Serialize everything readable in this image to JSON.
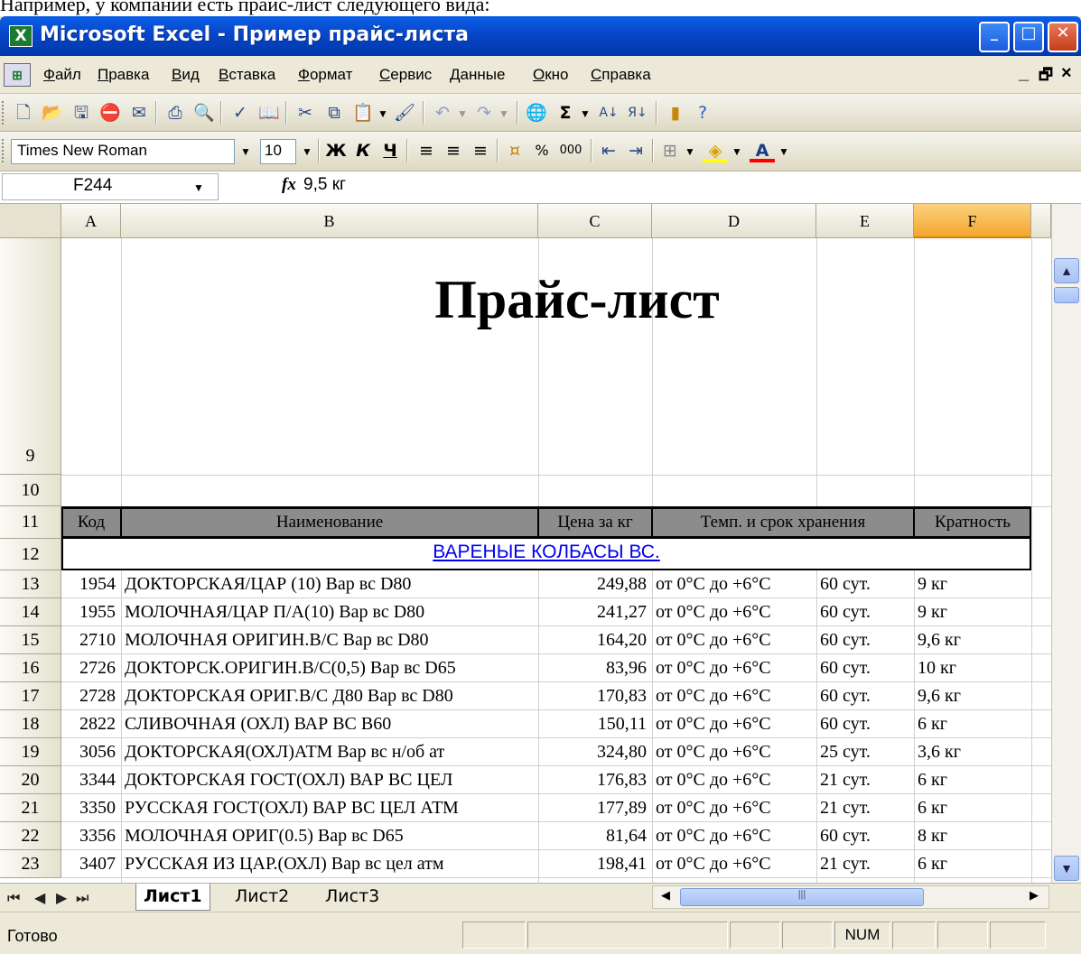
{
  "caption": "Например, у компании есть прайс-лист следующего вида:",
  "window": {
    "app_icon": "excel-icon",
    "title": "Microsoft Excel - Пример прайс-листа",
    "minimize": "_",
    "maximize": "□",
    "close": "✕"
  },
  "menu": {
    "items": [
      "Файл",
      "Правка",
      "Вид",
      "Вставка",
      "Формат",
      "Сервис",
      "Данные",
      "Окно",
      "Справка"
    ],
    "mdi_min": "_",
    "mdi_restore": "🗗",
    "mdi_close": "×"
  },
  "toolbar_standard": {
    "icons": [
      "new-icon",
      "open-icon",
      "save-icon",
      "permission-icon",
      "email-icon",
      "print-icon",
      "print-preview-icon",
      "spelling-icon",
      "research-icon",
      "cut-icon",
      "copy-icon",
      "paste-icon",
      "format-painter-icon",
      "undo-icon",
      "redo-icon",
      "hyperlink-icon",
      "autosum-icon",
      "sort-ascending-icon",
      "sort-descending-icon",
      "chart-wizard-icon",
      "help-icon"
    ]
  },
  "toolbar_formatting": {
    "font": "Times New Roman",
    "size": "10",
    "bold": "Ж",
    "italic": "К",
    "underline": "Ч",
    "percent": "%",
    "thousands": "000"
  },
  "formula_bar": {
    "cell": "F244",
    "fx": "fx",
    "value": "9,5 кг"
  },
  "columns": [
    "A",
    "B",
    "C",
    "D",
    "E",
    "F"
  ],
  "selected_column": "F",
  "title_row": "9",
  "empty_row": "10",
  "header_row": "11",
  "category_row": "12",
  "sheet_title": "Прайс-лист",
  "table_headers": {
    "code": "Код",
    "name": "Наименование",
    "price": "Цена за кг",
    "storage": "Темп. и срок хранения",
    "multiplicity": "Кратность"
  },
  "category": "ВАРЕНЫЕ КОЛБАСЫ ВС.",
  "rows": [
    {
      "row": "13",
      "code": "1954",
      "name": "ДОКТОРСКАЯ/ЦАР (10) Вар вс D80",
      "price": "249,88",
      "temp": "от 0°С до +6°С",
      "term": "60 сут.",
      "mult": "9 кг"
    },
    {
      "row": "14",
      "code": "1955",
      "name": "МОЛОЧНАЯ/ЦАР П/А(10) Вар вс D80",
      "price": "241,27",
      "temp": "от 0°С до +6°С",
      "term": "60 сут.",
      "mult": "9 кг"
    },
    {
      "row": "15",
      "code": "2710",
      "name": "МОЛОЧНАЯ ОРИГИН.В/С Вар вс D80",
      "price": "164,20",
      "temp": "от 0°С до +6°С",
      "term": "60 сут.",
      "mult": "9,6 кг"
    },
    {
      "row": "16",
      "code": "2726",
      "name": "ДОКТОРСК.ОРИГИН.В/С(0,5) Вар вс D65",
      "price": "83,96",
      "temp": "от 0°С до +6°С",
      "term": "60 сут.",
      "mult": "10 кг"
    },
    {
      "row": "17",
      "code": "2728",
      "name": "ДОКТОРСКАЯ ОРИГ.В/С Д80 Вар вс D80",
      "price": "170,83",
      "temp": "от 0°С до +6°С",
      "term": "60 сут.",
      "mult": "9,6 кг"
    },
    {
      "row": "18",
      "code": "2822",
      "name": "СЛИВОЧНАЯ (ОХЛ) ВАР ВС В60",
      "price": "150,11",
      "temp": "от 0°С до +6°С",
      "term": "60 сут.",
      "mult": "6 кг"
    },
    {
      "row": "19",
      "code": "3056",
      "name": "ДОКТОРСКАЯ(ОХЛ)АТМ Вар вс н/об ат",
      "price": "324,80",
      "temp": "от 0°С до +6°С",
      "term": "25 сут.",
      "mult": "3,6 кг"
    },
    {
      "row": "20",
      "code": "3344",
      "name": "ДОКТОРСКАЯ ГОСТ(ОХЛ) ВАР ВС ЦЕЛ",
      "price": "176,83",
      "temp": "от 0°С до +6°С",
      "term": "21 сут.",
      "mult": "6 кг"
    },
    {
      "row": "21",
      "code": "3350",
      "name": "РУССКАЯ ГОСТ(ОХЛ) ВАР ВС ЦЕЛ АТМ",
      "price": "177,89",
      "temp": "от 0°С до +6°С",
      "term": "21 сут.",
      "mult": "6 кг"
    },
    {
      "row": "22",
      "code": "3356",
      "name": "МОЛОЧНАЯ ОРИГ(0.5) Вар вс D65",
      "price": "81,64",
      "temp": "от 0°С до +6°С",
      "term": "60 сут.",
      "mult": "8 кг"
    },
    {
      "row": "23",
      "code": "3407",
      "name": "РУССКАЯ ИЗ ЦАР.(ОХЛ) Вар вс цел атм",
      "price": "198,41",
      "temp": "от 0°С до +6°С",
      "term": "21 сут.",
      "mult": "6 кг"
    }
  ],
  "sheet_tabs": [
    "Лист1",
    "Лист2",
    "Лист3"
  ],
  "active_tab": "Лист1",
  "status": {
    "ready": "Готово",
    "num": "NUM"
  }
}
